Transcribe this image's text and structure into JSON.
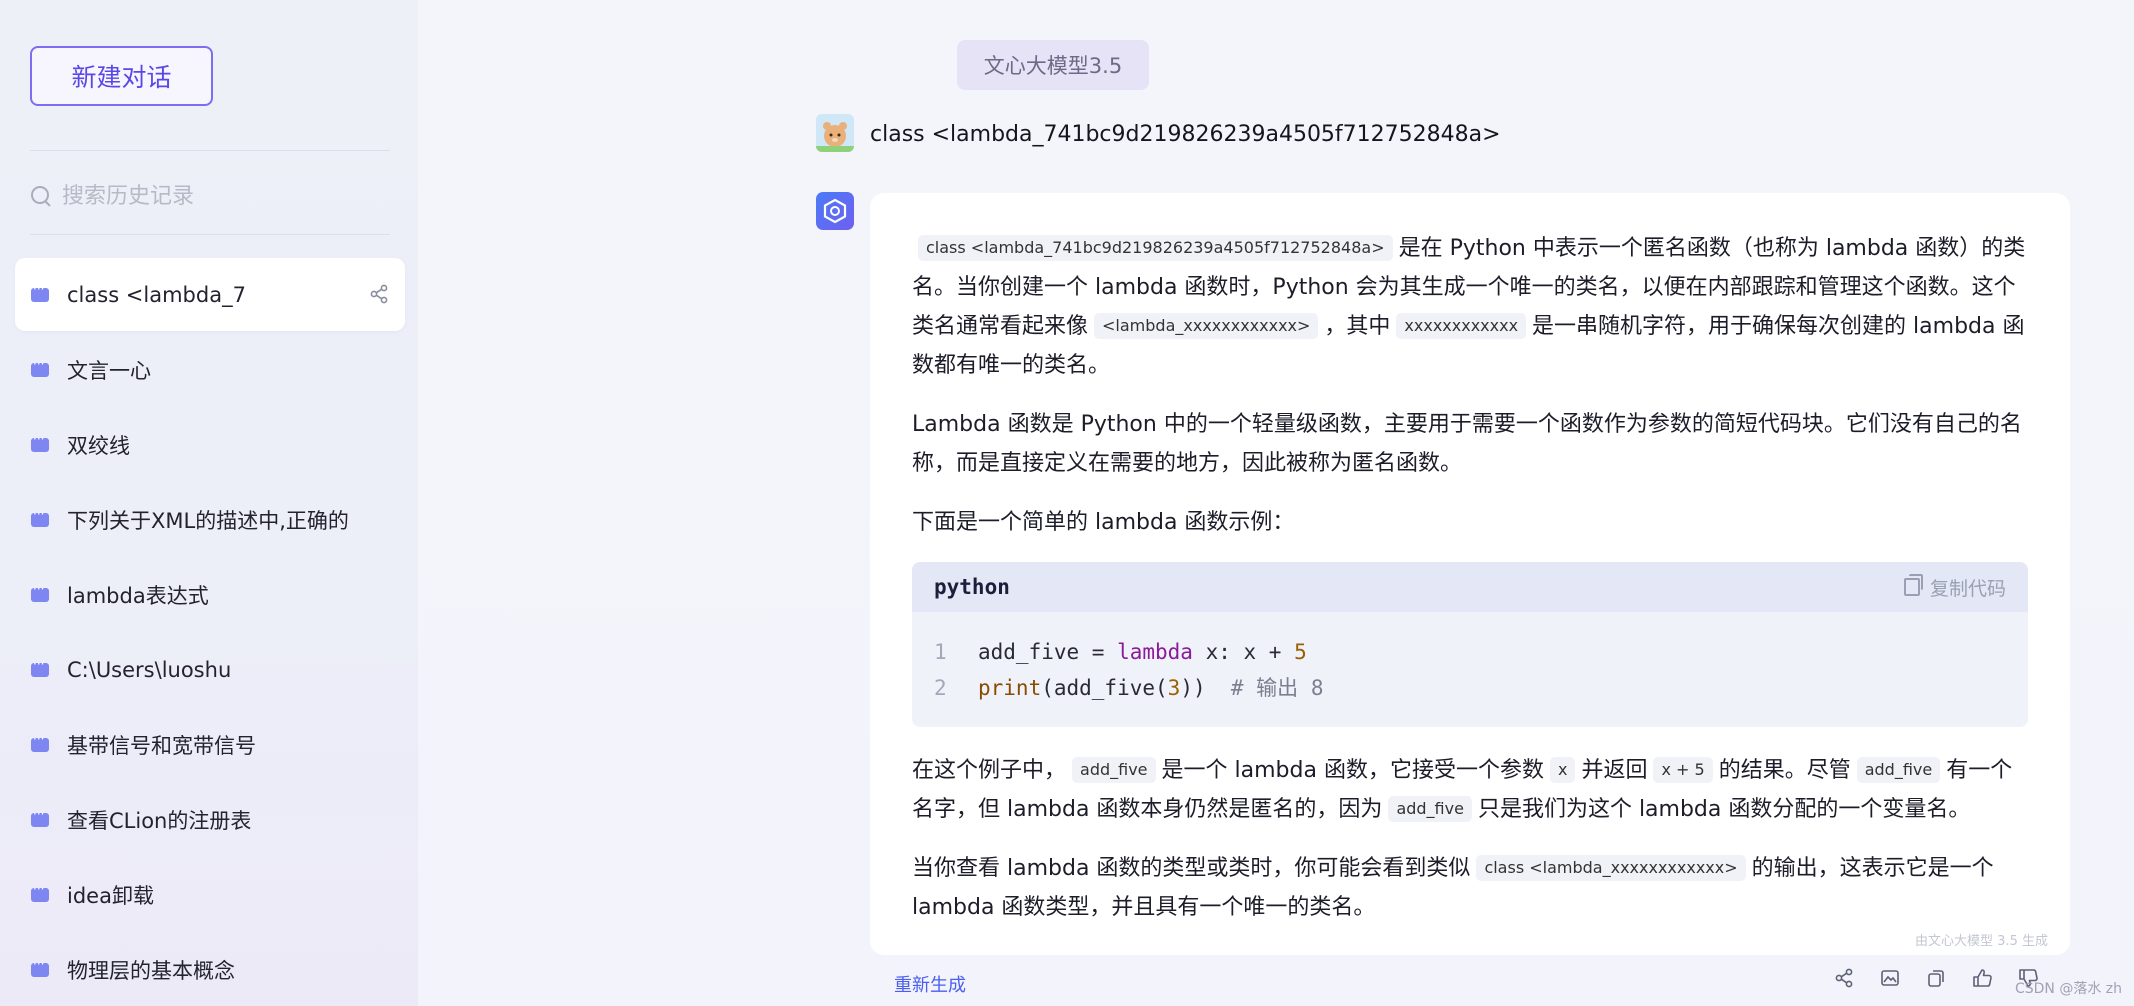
{
  "sidebar": {
    "new_chat": "新建对话",
    "search_placeholder": "搜索历史记录",
    "items": [
      {
        "label": "class <lambda_7",
        "active": true
      },
      {
        "label": "文言一心"
      },
      {
        "label": "双绞线"
      },
      {
        "label": "下列关于XML的描述中,正确的"
      },
      {
        "label": "lambda表达式"
      },
      {
        "label": "C:\\Users\\luoshu"
      },
      {
        "label": "基带信号和宽带信号"
      },
      {
        "label": "查看CLion的注册表"
      },
      {
        "label": "idea卸载"
      },
      {
        "label": "物理层的基本概念"
      }
    ]
  },
  "header": {
    "model": "文心大模型3.5"
  },
  "user_message": "class <lambda_741bc9d219826239a4505f712752848a>",
  "answer": {
    "p1": {
      "code1": "class <lambda_741bc9d219826239a4505f712752848a>",
      "t1": "是在 Python 中表示一个匿名函数（也称为 lambda 函数）的类名。当你创建一个 lambda 函数时，Python 会为其生成一个唯一的类名，以便在内部跟踪和管理这个函数。这个类名通常看起来像",
      "code2": "<lambda_xxxxxxxxxxxx>",
      "t2": "，其中",
      "code3": "xxxxxxxxxxxx",
      "t3": "是一串随机字符，用于确保每次创建的 lambda 函数都有唯一的类名。"
    },
    "p2": "Lambda 函数是 Python 中的一个轻量级函数，主要用于需要一个函数作为参数的简短代码块。它们没有自己的名称，而是直接定义在需要的地方，因此被称为匿名函数。",
    "p3": "下面是一个简单的 lambda 函数示例：",
    "code_block": {
      "lang": "python",
      "copy_label": "复制代码",
      "line_numbers": [
        "1",
        "2"
      ],
      "line1": {
        "a": "add_five = ",
        "kw": "lambda",
        "b": " x: x + ",
        "num": "5"
      },
      "line2": {
        "fn": "print",
        "a": "(add_five(",
        "num": "3",
        "b": "))  ",
        "cmt": "# 输出 8"
      }
    },
    "p4": {
      "t1": "在这个例子中，",
      "c1": "add_five",
      "t2": "是一个 lambda 函数，它接受一个参数",
      "c2": "x",
      "t3": "并返回",
      "c3": "x + 5",
      "t4": "的结果。尽管",
      "c4": "add_five",
      "t5": "有一个名字，但 lambda 函数本身仍然是匿名的，因为",
      "c5": "add_five",
      "t6": "只是我们为这个 lambda 函数分配的一个变量名。"
    },
    "p5": {
      "t1": "当你查看 lambda 函数的类型或类时，你可能会看到类似",
      "c1": "class <lambda_xxxxxxxxxxxx>",
      "t2": "的输出，这表示它是一个 lambda 函数类型，并且具有一个唯一的类名。"
    },
    "generated_by": "由文心大模型 3.5 生成"
  },
  "footer": {
    "regenerate": "重新生成",
    "watermark": "CSDN @落水 zh",
    "icons": [
      "share-icon",
      "image-icon",
      "copy-icon",
      "thumbs-up-icon",
      "thumbs-down-icon"
    ]
  },
  "colors": {
    "accent": "#5a48e6",
    "link": "#4a5ff0",
    "chat_icon": "#7e86f2"
  }
}
